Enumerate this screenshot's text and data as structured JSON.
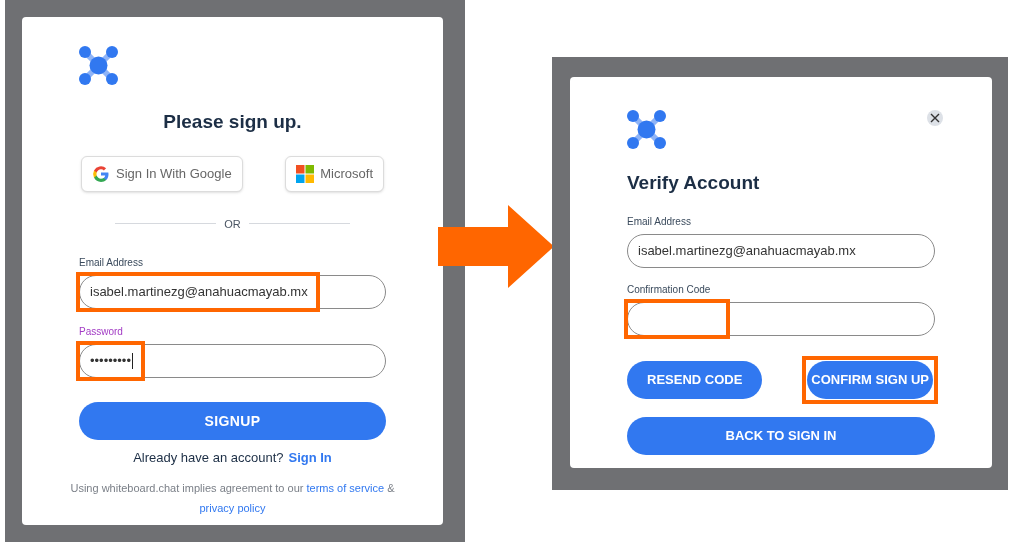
{
  "signup": {
    "title": "Please sign up.",
    "social_buttons": [
      {
        "kind": "google",
        "label": "Sign In With Google"
      },
      {
        "kind": "microsoft",
        "label": "Microsoft"
      }
    ],
    "divider": "OR",
    "fields": [
      {
        "label": "Email Address",
        "value": "isabel.martinezg@anahuacmayab.mx",
        "focused": false,
        "highlighted": true
      },
      {
        "label": "Password",
        "value": "•••••••••",
        "focused": true,
        "highlighted": true
      }
    ],
    "submit": "SIGNUP",
    "signin_prompt": "Already have an account?",
    "signin_link": "Sign In",
    "terms": [
      {
        "kind": "text",
        "text": "Using whiteboard.chat implies agreement to our"
      },
      {
        "kind": "link",
        "text": "terms of service"
      },
      {
        "kind": "text",
        "text": "&"
      },
      {
        "kind": "link",
        "text": "privacy policy"
      }
    ]
  },
  "verify": {
    "title": "Verify Account",
    "fields": [
      {
        "label": "Email Address",
        "value": "isabel.martinezg@anahuacmayab.mx",
        "focused": false,
        "highlighted": false
      },
      {
        "label": "Confirmation Code",
        "focused": false,
        "highlighted": true
      }
    ],
    "buttons": [
      {
        "label": "RESEND CODE",
        "highlighted": false
      },
      {
        "label": "CONFIRM SIGN UP",
        "highlighted": true
      }
    ],
    "back": "BACK TO SIGN IN"
  }
}
